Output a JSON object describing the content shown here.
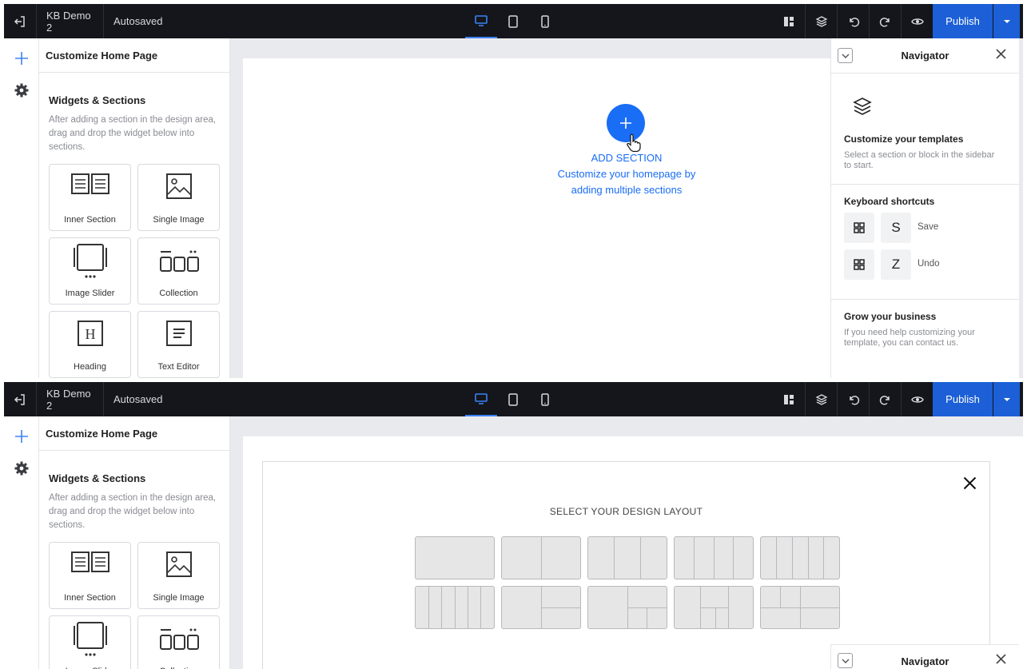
{
  "topbar": {
    "project_name": "KB Demo 2",
    "save_status": "Autosaved",
    "publish_label": "Publish"
  },
  "left_panel": {
    "title": "Customize Home Page",
    "widgets_title": "Widgets & Sections",
    "widgets_desc": "After adding a section in the design area, drag and drop the widget below into sections.",
    "widgets": [
      {
        "label": "Inner Section",
        "icon": "inner-section-icon"
      },
      {
        "label": "Single Image",
        "icon": "image-icon"
      },
      {
        "label": "Image Slider",
        "icon": "slider-icon"
      },
      {
        "label": "Collection",
        "icon": "collection-icon"
      },
      {
        "label": "Heading",
        "icon": "heading-icon"
      },
      {
        "label": "Text Editor",
        "icon": "text-editor-icon"
      }
    ]
  },
  "canvas": {
    "add_section_label": "ADD SECTION",
    "add_section_desc_line1": "Customize your homepage by",
    "add_section_desc_line2": "adding multiple sections"
  },
  "navigator": {
    "title": "Navigator",
    "templates_title": "Customize your templates",
    "templates_desc": "Select a section or block in the sidebar to start.",
    "shortcuts_title": "Keyboard shortcuts",
    "shortcuts": [
      {
        "key": "S",
        "label": "Save"
      },
      {
        "key": "Z",
        "label": "Undo"
      }
    ],
    "grow_title": "Grow your business",
    "grow_desc": "If you need help customizing your template, you can contact us."
  },
  "layout_modal": {
    "title": "SELECT YOUR DESIGN LAYOUT"
  },
  "colors": {
    "topbar_bg": "#14161c",
    "accent": "#1a6df5",
    "publish_bg": "#1c5fd6"
  }
}
